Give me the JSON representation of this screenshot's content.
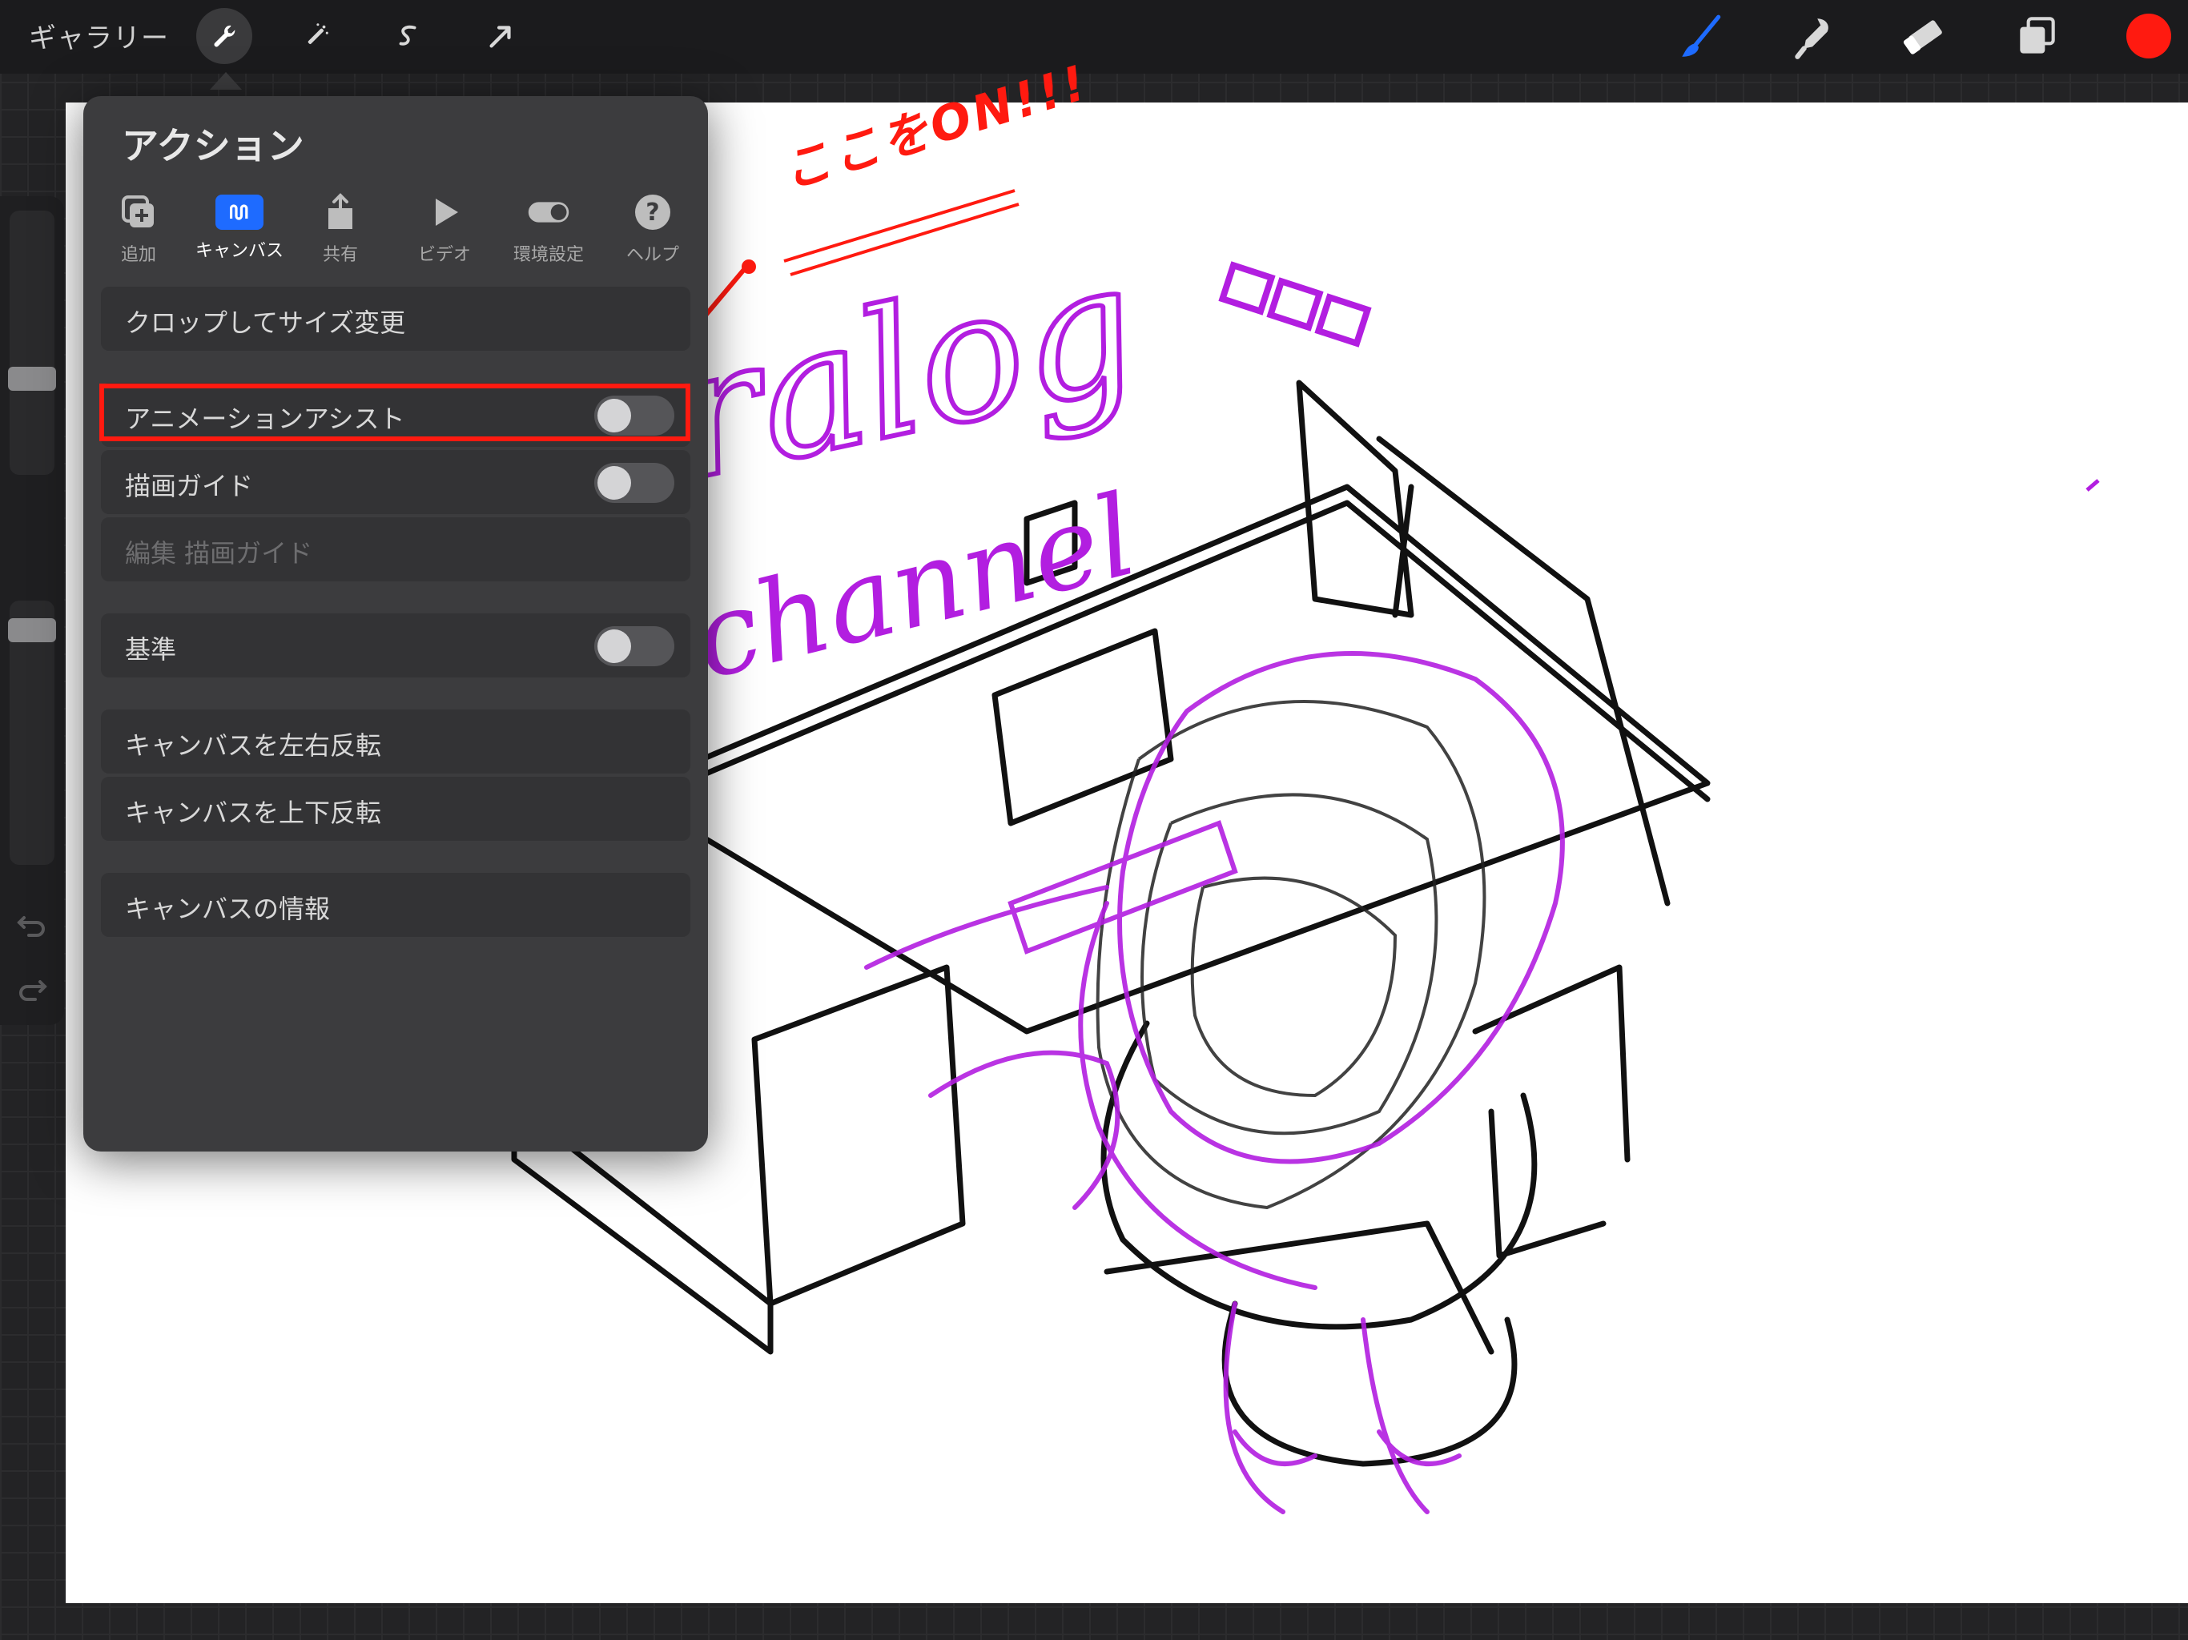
{
  "toolbar": {
    "gallery_label": "ギャラリー",
    "left_tools": [
      "wrench-icon",
      "magic-wand-icon",
      "selection-icon",
      "transform-arrow-icon"
    ],
    "right_tools": [
      "brush-icon",
      "smudge-icon",
      "eraser-icon",
      "layers-icon"
    ],
    "active_color": "#ff1a10",
    "brush_color": "#1e6bff"
  },
  "actions": {
    "title": "アクション",
    "tabs": [
      {
        "label": "追加",
        "icon": "add-icon"
      },
      {
        "label": "キャンバス",
        "icon": "canvas-icon",
        "active": true
      },
      {
        "label": "共有",
        "icon": "share-icon"
      },
      {
        "label": "ビデオ",
        "icon": "play-icon"
      },
      {
        "label": "環境設定",
        "icon": "toggle-icon"
      },
      {
        "label": "ヘルプ",
        "icon": "help-icon"
      }
    ],
    "items": {
      "crop": "クロップしてサイズ変更",
      "animation_assist": "アニメーションアシスト",
      "drawing_guide": "描画ガイド",
      "edit_drawing_guide": "編集 描画ガイド",
      "reference": "基準",
      "flip_horizontal": "キャンバスを左右反転",
      "flip_vertical": "キャンバスを上下反転",
      "canvas_info": "キャンバスの情報"
    },
    "toggles": {
      "animation_assist": false,
      "drawing_guide": false,
      "reference": false
    }
  },
  "annotation": {
    "text": "ここをON!!!",
    "color": "#ff1a10"
  },
  "sketch": {
    "handwriting_line1": "ralog",
    "handwriting_line2": "channel",
    "ink_color": "#b21ee0"
  }
}
